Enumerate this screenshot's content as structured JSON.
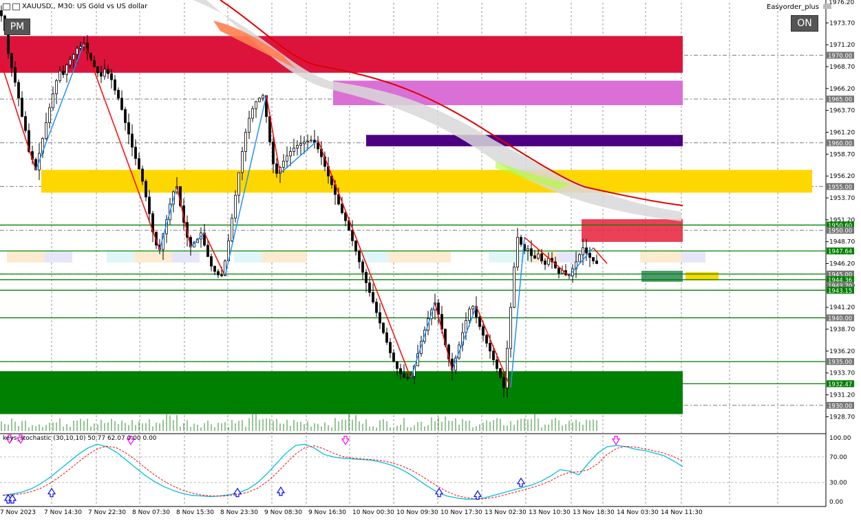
{
  "header": {
    "symbol": "XAUUSD.",
    "timeframe": "M30",
    "description": "US Gold vs US dollar",
    "title_text": "XAUUSD., M30:  US Gold vs US dollar"
  },
  "buttons": {
    "pm_label": "PM",
    "on_label": "ON"
  },
  "expert": {
    "name": "Easyorder_plus"
  },
  "indicator": {
    "label": "keys_stochastic (30,10,10) 50.77 62.07 0.00 0.00"
  },
  "colors": {
    "zone_red": "#DC143C",
    "zone_magenta": "#DA70D6",
    "zone_purple": "#4B0082",
    "zone_gold": "#FFD700",
    "zone_green": "#008000",
    "hline_green": "#008000",
    "zigzag_red": "#FF0000",
    "zigzag_blue": "#1E90FF",
    "ma_red": "#E00000",
    "stoch_main": "#00BFD8",
    "stoch_signal": "#FF0000",
    "arrow_down": "#FF00FF",
    "arrow_up": "#0000FF"
  },
  "price_axis": {
    "min": 1927.0,
    "max": 1976.0,
    "ticks": [
      "1973.70",
      "1971.20",
      "1968.70",
      "1966.20",
      "1963.70",
      "1961.20",
      "1958.70",
      "1956.20",
      "1953.70",
      "1951.20",
      "1948.70",
      "1946.20",
      "1943.70",
      "1941.20",
      "1938.70",
      "1936.20",
      "1933.70",
      "1931.20",
      "1928.70"
    ],
    "tick_values": [
      1973.7,
      1971.2,
      1968.7,
      1966.2,
      1963.7,
      1961.2,
      1958.7,
      1956.2,
      1953.7,
      1951.2,
      1948.7,
      1946.2,
      1943.7,
      1941.2,
      1938.7,
      1936.2,
      1933.7,
      1931.2,
      1928.7
    ],
    "top_label": "1976.20",
    "labels": [
      {
        "text": "1970.00",
        "value": 1970.0,
        "style": "gray"
      },
      {
        "text": "1965.00",
        "value": 1965.0,
        "style": "gray"
      },
      {
        "text": "1960.00",
        "value": 1960.0,
        "style": "gray"
      },
      {
        "text": "1955.00",
        "value": 1955.0,
        "style": "gray"
      },
      {
        "text": "1950.60",
        "value": 1950.6,
        "style": "green"
      },
      {
        "text": "1950.00",
        "value": 1950.0,
        "style": "gray"
      },
      {
        "text": "1947.64",
        "value": 1947.64,
        "style": "green"
      },
      {
        "text": "1945.00",
        "value": 1945.0,
        "style": "gray"
      },
      {
        "text": "1944.36",
        "value": 1944.36,
        "style": "green"
      },
      {
        "text": "1943.70",
        "value": 1943.7,
        "style": "gray"
      },
      {
        "text": "1943.15",
        "value": 1943.15,
        "style": "green"
      },
      {
        "text": "1940.00",
        "value": 1940.0,
        "style": "gray"
      },
      {
        "text": "1935.00",
        "value": 1935.0,
        "style": "gray"
      },
      {
        "text": "1932.47",
        "value": 1932.47,
        "style": "green"
      },
      {
        "text": "1930.00",
        "value": 1930.0,
        "style": "gray"
      }
    ]
  },
  "stoch_axis": {
    "ticks": [
      "100.00",
      "70.00",
      "30.00",
      "0.00"
    ],
    "tick_values": [
      100,
      70,
      30,
      0
    ]
  },
  "time_axis": {
    "labels": [
      "7 Nov 2023",
      "7 Nov 14:30",
      "7 Nov 22:30",
      "8 Nov 07:30",
      "8 Nov 15:30",
      "8 Nov 23:30",
      "9 Nov 08:30",
      "9 Nov 16:30",
      "10 Nov 00:30",
      "10 Nov 09:30",
      "10 Nov 17:30",
      "13 Nov 02:30",
      "13 Nov 10:30",
      "13 Nov 18:30",
      "14 Nov 03:30",
      "14 Nov 11:30"
    ]
  },
  "chart_data": {
    "type": "candlestick",
    "symbol": "XAUUSD.",
    "timeframe": "M30",
    "ylim": [
      1927.0,
      1976.0
    ],
    "zones": [
      {
        "color": "red",
        "from": 1968.0,
        "to": 1972.2
      },
      {
        "color": "magenta",
        "from": 1964.3,
        "to": 1967.1
      },
      {
        "color": "purple",
        "from": 1959.6,
        "to": 1960.9
      },
      {
        "color": "gold",
        "from": 1954.3,
        "to": 1956.9
      },
      {
        "color": "green",
        "from": 1929.0,
        "to": 1933.9
      }
    ],
    "horizontal_levels": [
      1950.6,
      1947.64,
      1945.0,
      1944.36,
      1943.15,
      1940.0,
      1935.0,
      1932.47
    ],
    "zigzag": [
      {
        "t": 0,
        "p": 1969.0
      },
      {
        "t": 10,
        "p": 1956.9
      },
      {
        "t": 24,
        "p": 1971.4
      },
      {
        "t": 46,
        "p": 1947.8
      },
      {
        "t": 51,
        "p": 1955.0
      },
      {
        "t": 55,
        "p": 1948.1
      },
      {
        "t": 59,
        "p": 1949.7
      },
      {
        "t": 65,
        "p": 1944.8
      },
      {
        "t": 77,
        "p": 1965.4
      },
      {
        "t": 81,
        "p": 1956.5
      },
      {
        "t": 92,
        "p": 1960.3
      },
      {
        "t": 119,
        "p": 1933.1
      },
      {
        "t": 126,
        "p": 1941.7
      },
      {
        "t": 131,
        "p": 1934.0
      },
      {
        "t": 138,
        "p": 1941.3
      },
      {
        "t": 148,
        "p": 1932.0
      },
      {
        "t": 152,
        "p": 1949.2
      },
      {
        "t": 165,
        "p": 1944.8
      },
      {
        "t": 172,
        "p": 1948.0
      },
      {
        "t": 176,
        "p": 1946.2
      }
    ],
    "candles_close": [
      1974.5,
      1972.8,
      1970.2,
      1968.6,
      1966.9,
      1965.1,
      1963.0,
      1961.4,
      1959.0,
      1958.1,
      1956.9,
      1958.8,
      1960.5,
      1962.3,
      1964.0,
      1965.6,
      1967.1,
      1968.2,
      1967.8,
      1968.9,
      1969.5,
      1970.1,
      1970.8,
      1971.0,
      1971.4,
      1970.2,
      1969.4,
      1968.7,
      1968.0,
      1967.6,
      1968.4,
      1967.9,
      1967.2,
      1966.0,
      1965.1,
      1963.8,
      1962.3,
      1961.0,
      1959.5,
      1958.2,
      1957.0,
      1955.6,
      1953.8,
      1951.9,
      1949.8,
      1948.3,
      1947.8,
      1949.6,
      1951.2,
      1953.0,
      1954.4,
      1955.0,
      1952.8,
      1950.9,
      1949.2,
      1948.1,
      1948.6,
      1949.0,
      1949.7,
      1948.3,
      1947.0,
      1945.9,
      1945.3,
      1944.9,
      1944.8,
      1946.5,
      1948.8,
      1951.4,
      1954.0,
      1956.6,
      1959.0,
      1961.2,
      1962.8,
      1963.9,
      1964.7,
      1965.1,
      1965.4,
      1963.0,
      1960.1,
      1957.6,
      1956.5,
      1957.2,
      1957.9,
      1958.5,
      1959.0,
      1959.4,
      1959.7,
      1959.9,
      1960.1,
      1960.2,
      1960.3,
      1960.0,
      1959.3,
      1958.4,
      1957.3,
      1956.2,
      1955.2,
      1954.1,
      1953.0,
      1952.0,
      1951.1,
      1950.0,
      1948.8,
      1947.6,
      1946.4,
      1945.2,
      1944.0,
      1942.9,
      1941.8,
      1940.6,
      1939.4,
      1938.3,
      1937.2,
      1936.0,
      1935.0,
      1934.2,
      1933.6,
      1933.2,
      1933.1,
      1933.3,
      1934.5,
      1935.9,
      1937.3,
      1938.6,
      1939.9,
      1940.9,
      1941.7,
      1940.4,
      1938.7,
      1936.9,
      1935.3,
      1934.0,
      1935.4,
      1936.9,
      1938.3,
      1939.7,
      1941.0,
      1941.3,
      1940.1,
      1939.0,
      1938.0,
      1937.1,
      1936.2,
      1935.2,
      1934.2,
      1933.2,
      1932.0,
      1936.5,
      1941.2,
      1945.8,
      1949.2,
      1948.4,
      1947.7,
      1947.9,
      1947.1,
      1946.8,
      1947.3,
      1946.5,
      1946.1,
      1946.8,
      1946.4,
      1945.7,
      1945.1,
      1945.4,
      1944.9,
      1944.8,
      1945.6,
      1946.4,
      1947.2,
      1948.0,
      1947.4,
      1946.9,
      1946.5,
      1946.2
    ],
    "moving_average": [
      {
        "t": 40,
        "p": 1978.0
      },
      {
        "t": 90,
        "p": 1966.4
      },
      {
        "t": 120,
        "p": 1962.4
      },
      {
        "t": 150,
        "p": 1956.8
      },
      {
        "t": 180,
        "p": 1952.9
      },
      {
        "t": 196,
        "p": 1951.0
      }
    ],
    "indicator": {
      "name": "keys_stochastic",
      "params": [
        30,
        10,
        10
      ],
      "values": [
        50.77,
        62.07,
        0.0,
        0.0
      ],
      "ylim": [
        0,
        100
      ]
    }
  }
}
